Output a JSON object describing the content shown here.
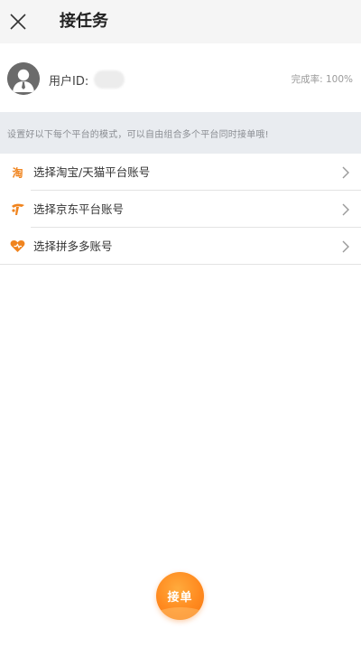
{
  "header": {
    "title": "接任务"
  },
  "user": {
    "id_label": "用户ID:",
    "completion_text": "完成率: 100%"
  },
  "notice": {
    "text": "设置好以下每个平台的模式，可以自由组合多个平台同时接单哦!"
  },
  "platforms": [
    {
      "label": "选择淘宝/天猫平台账号",
      "icon": "taobao-icon"
    },
    {
      "label": "选择京东平台账号",
      "icon": "jingdong-icon"
    },
    {
      "label": "选择拼多多账号",
      "icon": "pinduoduo-icon"
    }
  ],
  "accept_button": {
    "label": "接单"
  },
  "colors": {
    "accent": "#f0841e",
    "header_bg": "#f5f5f5",
    "notice_bg": "#e9ecf0"
  }
}
